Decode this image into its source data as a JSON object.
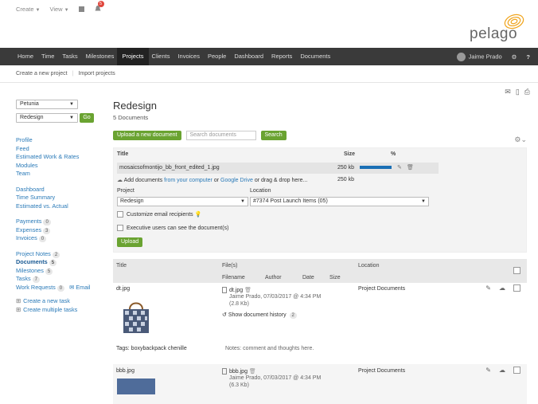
{
  "top_menu": {
    "create": "Create",
    "view": "View",
    "notifications_count": "5"
  },
  "logo_text": "pelago",
  "nav": {
    "items": [
      "Home",
      "Time",
      "Tasks",
      "Milestones",
      "Projects",
      "Clients",
      "Invoices",
      "People",
      "Dashboard",
      "Reports",
      "Documents"
    ],
    "active": "Projects",
    "user_name": "Jaime Prado",
    "help": "?"
  },
  "subnav": {
    "create_project": "Create a new project",
    "import_projects": "Import projects"
  },
  "sidebar": {
    "client_select": "Petunia",
    "project_select": "Redesign",
    "go_label": "Go",
    "group1": [
      "Profile",
      "Feed",
      "Estimated Work & Rates",
      "Modules",
      "Team"
    ],
    "group2": [
      "Dashboard",
      "Time Summary",
      "Estimated vs. Actual"
    ],
    "payments": {
      "label": "Payments",
      "count": "0"
    },
    "expenses": {
      "label": "Expenses",
      "count": "3"
    },
    "invoices": {
      "label": "Invoices",
      "count": "0"
    },
    "project_notes": {
      "label": "Project Notes",
      "count": "2"
    },
    "documents": {
      "label": "Documents",
      "count": "5"
    },
    "milestones": {
      "label": "Milestones",
      "count": "5"
    },
    "tasks": {
      "label": "Tasks",
      "count": "7"
    },
    "work_requests": {
      "label": "Work Requests",
      "count": "0",
      "email": "Email"
    },
    "create_task": "Create a new task",
    "create_multiple": "Create multiple tasks"
  },
  "main": {
    "title": "Redesign",
    "subtitle": "5 Documents",
    "upload_button": "Upload a new document",
    "search_placeholder": "Search documents",
    "search_button": "Search"
  },
  "upload": {
    "col_title": "Title",
    "col_size": "Size",
    "col_percent": "%",
    "file_name": "mosaicsofmontijo_bb_front_edited_1.jpg",
    "file_size": "250 kb",
    "progress": 1.0,
    "add_docs_prefix": "Add documents",
    "from_computer": "from your computer",
    "or": "or",
    "google_drive": "Google Drive",
    "drag_drop": "or drag & drop here...",
    "total_size": "250 kb",
    "project_label": "Project",
    "project_value": "Redesign",
    "location_label": "Location",
    "location_value": "#7374 Post Launch Items (05)",
    "customize_label": "Customize email recipients",
    "exec_label": "Executive users can see the document(s)",
    "upload_button": "Upload"
  },
  "table": {
    "col_title": "Title",
    "col_files": "File(s)",
    "col_location": "Location",
    "sub_filename": "Filename",
    "sub_author": "Author",
    "sub_date": "Date",
    "sub_size": "Size",
    "rows": [
      {
        "title": "dt.jpg",
        "file": "dt.jpg",
        "meta": "Jaime Prado, 07/03/2017 @ 4:34 PM",
        "size": "(2.8 Kb)",
        "history": "Show document history",
        "history_count": "2",
        "location": "Project Documents",
        "tags": "Tags: boxybackpack chenille",
        "notes": "Notes: comment and thoughts here."
      },
      {
        "title": "bbb.jpg",
        "file": "bbb.jpg",
        "meta": "Jaime Prado, 07/03/2017 @ 4:34 PM",
        "size": "(6.3 Kb)",
        "location": "Project Documents"
      }
    ]
  }
}
